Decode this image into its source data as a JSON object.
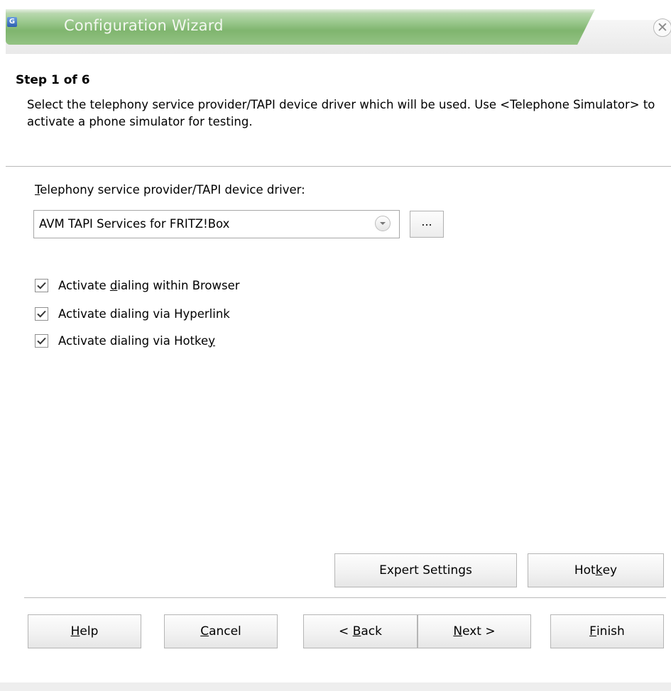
{
  "window": {
    "title": "Configuration Wizard",
    "icon": "app-icon",
    "close_glyph": "✕"
  },
  "header": {
    "step": "Step 1 of 6",
    "description": "Select the telephony service provider/TAPI device driver which will be used. Use <Telephone Simulator> to activate a phone simulator for testing."
  },
  "provider": {
    "label_mnemonic": "T",
    "label_rest": "elephony service provider/TAPI device driver:",
    "selected_value": "AVM TAPI Services for FRITZ!Box",
    "dropdown_icon": "chevron-down-icon",
    "browse_label": "..."
  },
  "options": [
    {
      "before": "Activate ",
      "mnemonic": "d",
      "after": "ialing within Browser",
      "checked": true
    },
    {
      "before": "Activate dialing via Hyperlink",
      "mnemonic": "",
      "after": "",
      "checked": true
    },
    {
      "before": "Activate dialing via Hotke",
      "mnemonic": "y",
      "after": "",
      "checked": true
    }
  ],
  "actions": {
    "expert_settings": "Expert Settings",
    "hotkey_before": "Hot",
    "hotkey_mnemonic": "k",
    "hotkey_after": "ey"
  },
  "footer": {
    "help_mnemonic": "H",
    "help_rest": "elp",
    "cancel_mnemonic": "C",
    "cancel_rest": "ancel",
    "back_before": "< ",
    "back_mnemonic": "B",
    "back_rest": "ack",
    "next_mnemonic": "N",
    "next_rest": "ext >",
    "finish_mnemonic": "F",
    "finish_rest": "inish"
  },
  "colors": {
    "titlebar_green": "#8fc07f",
    "checkmark": "#333333"
  }
}
